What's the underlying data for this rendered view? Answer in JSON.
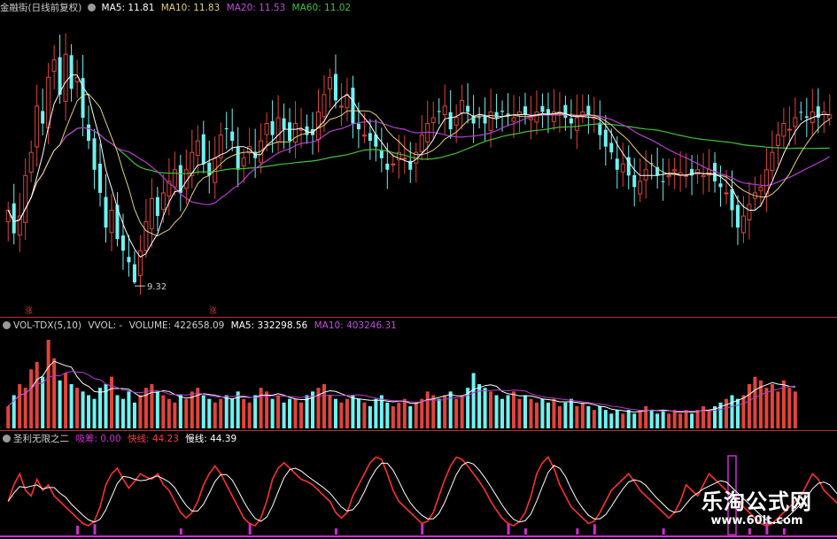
{
  "main_header": {
    "title": "金融街(日线前复权)",
    "ma5_label": "MA5: 11.81",
    "ma10_label": "MA10: 11.83",
    "ma20_label": "MA20: 11.53",
    "ma60_label": "MA60: 11.02"
  },
  "vol_header": {
    "title": "VOL-TDX(5,10)",
    "vvol_label": "VVOL: -",
    "volume_label": "VOLUME: 422658.09",
    "ma5_label": "MA5: 332298.56",
    "ma10_label": "MA10: 403246.31"
  },
  "ind_header": {
    "title": "圣利无限之二",
    "buy_label": "吸筹: 0.00",
    "fast_label": "快线: 44.23",
    "slow_label": "慢线: 44.39"
  },
  "low_marker": "9.32",
  "tags": [
    "涨",
    "涨"
  ],
  "watermark": {
    "title": "乐淘公式网",
    "url": "www.60lt.com"
  },
  "colors": {
    "up": "#e0443a",
    "down": "#6ff2f2",
    "ma5": "#ffffff",
    "ma10": "#e3d07a",
    "ma20": "#b63dd0",
    "ma60": "#3fc43a",
    "fast": "#ff2f2f",
    "slow": "#ffffff",
    "buy": "#d02cd0",
    "separator": "#b8322b"
  },
  "chart_data": {
    "type": "candlestick",
    "title": "金融街(日线前复权)",
    "price_range": [
      9.0,
      13.9
    ],
    "marked_low": 9.32,
    "last_ma": {
      "MA5": 11.81,
      "MA10": 11.83,
      "MA20": 11.53,
      "MA60": 11.02
    },
    "volume_last": {
      "VOLUME": 422658.09,
      "MA5": 332298.56,
      "MA10": 403246.31
    },
    "indicator_last": {
      "吸筹": 0.0,
      "快线": 44.23,
      "慢线": 44.39
    },
    "close": [
      10.6,
      10.2,
      10.5,
      11.2,
      11.6,
      12.4,
      12.1,
      12.9,
      13.2,
      12.6,
      13.3,
      12.7,
      12.9,
      12.2,
      11.8,
      11.3,
      10.9,
      10.3,
      10.6,
      10.1,
      9.9,
      9.7,
      9.35,
      9.9,
      10.4,
      10.8,
      10.5,
      10.9,
      11.1,
      11.3,
      10.9,
      11.3,
      11.6,
      11.8,
      11.4,
      11.2,
      11.5,
      11.9,
      12.0,
      11.8,
      11.3,
      11.5,
      11.7,
      11.5,
      11.8,
      12.1,
      11.9,
      12.2,
      12.0,
      11.8,
      12.1,
      12.0,
      11.9,
      11.9,
      12.3,
      12.6,
      12.9,
      12.5,
      12.4,
      12.6,
      12.1,
      12.0,
      11.9,
      11.8,
      11.7,
      11.5,
      11.3,
      11.4,
      11.6,
      11.5,
      11.3,
      11.6,
      11.9,
      12.1,
      12.2,
      12.3,
      12.4,
      12.0,
      12.2,
      12.5,
      12.3,
      12.1,
      12.2,
      12.1,
      12.3,
      12.2,
      12.3,
      12.25,
      12.2,
      12.3,
      12.25,
      12.2,
      12.3,
      12.3,
      12.25,
      12.3,
      12.3,
      12.2,
      12.1,
      12.2,
      12.3,
      12.25,
      12.2,
      11.9,
      11.7,
      11.6,
      11.3,
      11.4,
      11.2,
      11.0,
      11.1,
      11.3,
      11.4,
      11.2,
      11.1,
      11.2,
      11.3,
      11.25,
      11.2,
      11.2,
      11.3,
      11.2,
      11.3,
      11.1,
      11.0,
      10.9,
      10.6,
      10.3,
      10.5,
      10.7,
      10.9,
      11.0,
      11.3,
      11.6,
      11.9,
      12.1,
      12.0,
      12.2,
      12.3,
      12.2,
      12.3,
      12.2,
      12.3,
      12.25
    ],
    "volume": [
      30,
      45,
      60,
      55,
      80,
      90,
      70,
      120,
      95,
      65,
      75,
      60,
      55,
      50,
      45,
      40,
      55,
      60,
      70,
      45,
      40,
      50,
      35,
      45,
      55,
      60,
      50,
      45,
      40,
      35,
      45,
      40,
      50,
      55,
      45,
      40,
      35,
      40,
      45,
      40,
      50,
      40,
      35,
      45,
      55,
      50,
      40,
      45,
      35,
      40,
      40,
      35,
      45,
      50,
      55,
      60,
      45,
      40,
      35,
      40,
      45,
      40,
      35,
      30,
      40,
      45,
      35,
      30,
      35,
      40,
      30,
      35,
      40,
      50,
      45,
      40,
      45,
      50,
      40,
      45,
      55,
      75,
      60,
      55,
      50,
      45,
      40,
      45,
      50,
      40,
      45,
      40,
      35,
      40,
      35,
      40,
      30,
      35,
      40,
      30,
      35,
      30,
      25,
      30,
      25,
      20,
      25,
      20,
      25,
      20,
      25,
      30,
      25,
      20,
      25,
      20,
      25,
      20,
      25,
      20,
      25,
      30,
      25,
      30,
      35,
      40,
      45,
      40,
      45,
      60,
      70,
      65,
      55,
      60,
      50,
      65,
      55,
      50
    ],
    "fast": [
      30,
      45,
      55,
      40,
      35,
      50,
      40,
      45,
      35,
      30,
      25,
      20,
      15,
      10,
      8,
      12,
      25,
      45,
      55,
      60,
      50,
      42,
      48,
      55,
      52,
      50,
      55,
      45,
      40,
      30,
      20,
      15,
      20,
      30,
      45,
      55,
      62,
      55,
      45,
      35,
      25,
      15,
      10,
      8,
      15,
      30,
      50,
      60,
      65,
      60,
      55,
      50,
      48,
      45,
      40,
      35,
      30,
      20,
      15,
      20,
      35,
      45,
      55,
      65,
      70,
      68,
      55,
      40,
      30,
      25,
      20,
      15,
      10,
      12,
      20,
      35,
      50,
      62,
      70,
      68,
      62,
      55,
      48,
      40,
      30,
      22,
      15,
      10,
      8,
      12,
      20,
      35,
      55,
      65,
      70,
      60,
      45,
      35,
      25,
      20,
      15,
      10,
      12,
      20,
      30,
      40,
      45,
      50,
      55,
      48,
      40,
      35,
      30,
      25,
      20,
      15,
      20,
      30,
      45,
      40,
      35,
      45,
      55,
      50,
      45,
      40,
      35,
      30,
      25,
      20,
      15,
      10,
      8,
      10,
      15,
      20,
      25,
      30,
      35,
      45,
      55,
      50,
      40,
      35,
      30,
      25,
      20,
      15
    ]
  }
}
